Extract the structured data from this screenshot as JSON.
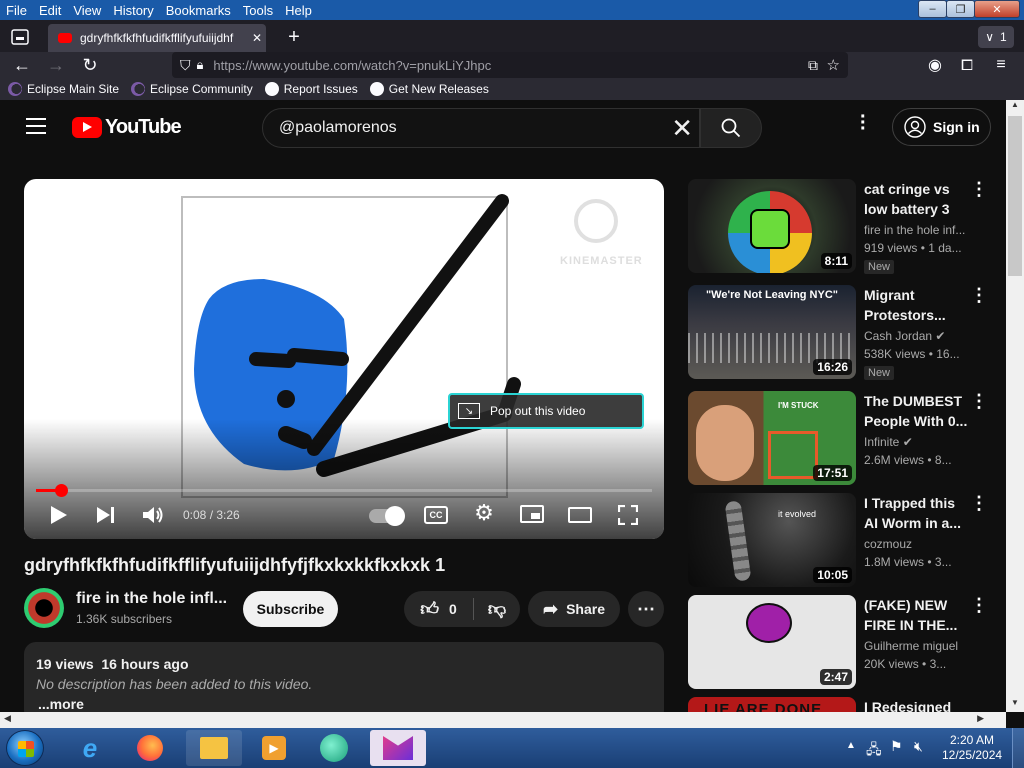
{
  "menu": [
    "File",
    "Edit",
    "View",
    "History",
    "Bookmarks",
    "Tools",
    "Help"
  ],
  "window_controls": {
    "minimize": "–",
    "maximize": "❐",
    "close": "✕"
  },
  "tab": {
    "title": "gdryfhfkfkfhfudifkfflifyufuiijdhf",
    "close": "✕",
    "new_tab": "+",
    "tab_count": "1"
  },
  "nav": {
    "url": "https://www.youtube.com/watch?v=pnukLiYJhpc"
  },
  "bookmarks": [
    "Eclipse Main Site",
    "Eclipse Community",
    "Report Issues",
    "Get New Releases"
  ],
  "youtube": {
    "logo": "YouTube",
    "search_value": "@paolamorenos",
    "signin": "Sign in",
    "video": {
      "watermark": "KINEMASTER",
      "popout_tooltip": "Pop out this video",
      "time": "0:08 / 3:26",
      "progress": 0.04,
      "title": "gdryfhfkfkfhfudifkfflifyufuiijdhfyfjfkxkxkkfkxkxk 1"
    },
    "channel": {
      "name": "fire in the hole infl...",
      "subs": "1.36K subscribers",
      "subscribe": "Subscribe"
    },
    "actions": {
      "likes": "0",
      "share": "Share"
    },
    "description": {
      "views": "19 views",
      "time": "16 hours ago",
      "text": "No description has been added to this video.",
      "more": "...more"
    },
    "recommendations": [
      {
        "title": "cat cringe vs low battery 3",
        "channel": "fire in the hole inf...",
        "views": "919 views",
        "age": "1 da...",
        "duration": "8:11",
        "badge": "New"
      },
      {
        "title": "Migrant Protestors...",
        "channel": "Cash Jordan",
        "views": "538K views",
        "age": "16...",
        "duration": "16:26",
        "badge": "New",
        "thumb_text": "\"We're Not Leaving NYC\""
      },
      {
        "title": "The DUMBEST People With 0...",
        "channel": "Infinite",
        "views": "2.6M views",
        "age": "8...",
        "duration": "17:51",
        "badge": "",
        "thumb_text": "I'M STUCK"
      },
      {
        "title": "I Trapped this AI Worm in a...",
        "channel": "cozmouz",
        "views": "1.8M views",
        "age": "3...",
        "duration": "10:05",
        "badge": "",
        "thumb_text": "it evolved"
      },
      {
        "title": "(FAKE) NEW FIRE IN THE...",
        "channel": "Guilherme miguel",
        "views": "20K views",
        "age": "3...",
        "duration": "2:47",
        "badge": ""
      },
      {
        "title": "I Redesigned",
        "channel": "",
        "views": "",
        "age": "",
        "duration": "",
        "badge": "",
        "thumb_text": "LIE ARE DONE"
      }
    ]
  },
  "taskbar": {
    "time": "2:20 AM",
    "date": "12/25/2024"
  }
}
